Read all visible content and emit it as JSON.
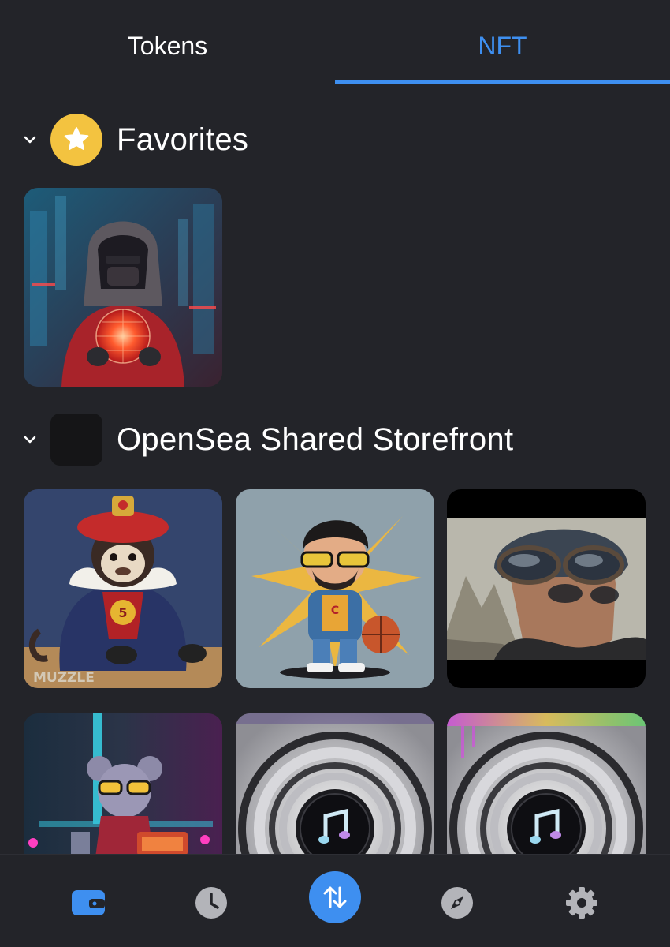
{
  "tabs": {
    "tokens": "Tokens",
    "nft": "NFT",
    "active": "NFT"
  },
  "collections": [
    {
      "name": "Favorites",
      "icon": "star-icon",
      "expanded": true,
      "items": [
        "hooded-figure-glowing-orb"
      ]
    },
    {
      "name": "OpenSea Shared Storefront",
      "icon": "blank-collection-icon",
      "expanded": true,
      "items": [
        "monkey-king-muzzle",
        "cartoon-basketball-player",
        "aviator-goggles-man",
        "mouse-dj-neon",
        "music-speaker-1",
        "music-speaker-2"
      ],
      "tile_caption": "MUZZLE"
    }
  ],
  "bottom_nav": {
    "items": [
      "wallet-icon",
      "history-icon",
      "swap-icon",
      "discover-icon",
      "settings-icon"
    ],
    "active": "wallet-icon"
  },
  "colors": {
    "background": "#232429",
    "accent": "#3e8ff0",
    "star": "#f3c340",
    "inactive_icon": "#b3b4b9"
  }
}
